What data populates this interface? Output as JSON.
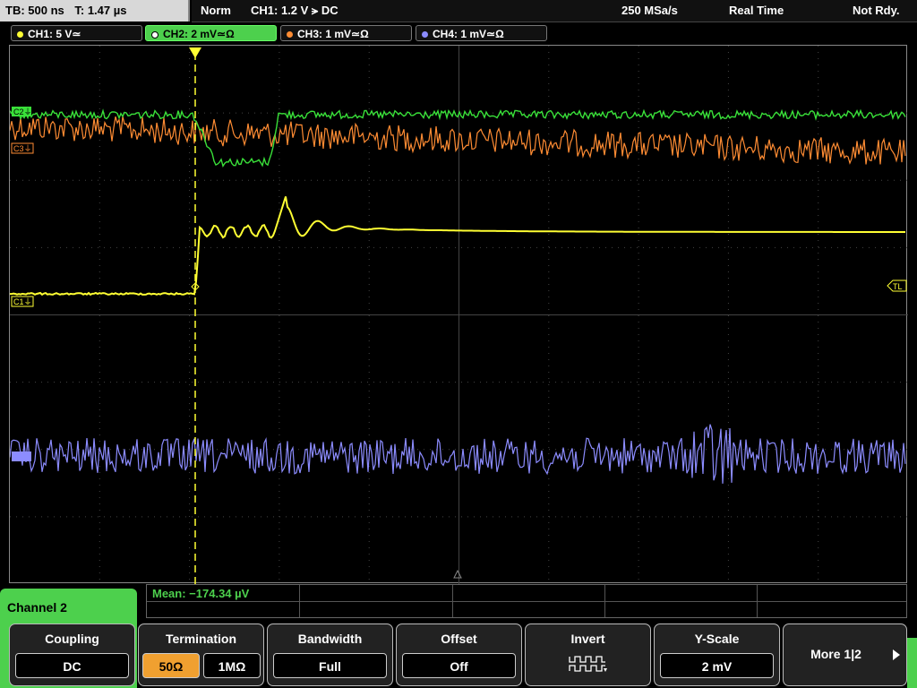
{
  "topbar": {
    "timebase": "TB: 500 ns",
    "trigger_pos": "T: 1.47 µs",
    "mode": "Norm",
    "trigger_setting": "CH1: 1.2 V ⪫ DC",
    "sample_rate": "250 MSa/s",
    "acq_mode": "Real Time",
    "status": "Not Rdy."
  },
  "channels": [
    {
      "label": "CH1: 5 V≃",
      "color": "#ffff33"
    },
    {
      "label": "CH2: 2 mV≃Ω",
      "color": "#4dd04d"
    },
    {
      "label": "CH3: 1 mV≃Ω",
      "color": "#ff8c33"
    },
    {
      "label": "CH4: 1 mV≃Ω",
      "color": "#8c8cff"
    }
  ],
  "markers": {
    "c1": "C1⏚",
    "c2": "C2⏚",
    "c3": "C3⏚",
    "tl": "TL"
  },
  "side_panel": {
    "title": "Channel 2"
  },
  "measurement": {
    "label": "Mean: −174.34 µV"
  },
  "softkeys": {
    "coupling": {
      "label": "Coupling",
      "value": "DC"
    },
    "termination": {
      "label": "Termination",
      "value_a": "50Ω",
      "value_b": "1MΩ"
    },
    "bandwidth": {
      "label": "Bandwidth",
      "value": "Full"
    },
    "offset": {
      "label": "Offset",
      "value": "Off"
    },
    "invert": {
      "label": "Invert"
    },
    "yscale": {
      "label": "Y-Scale",
      "value": "2 mV"
    },
    "more": {
      "label": "More 1|2"
    }
  }
}
